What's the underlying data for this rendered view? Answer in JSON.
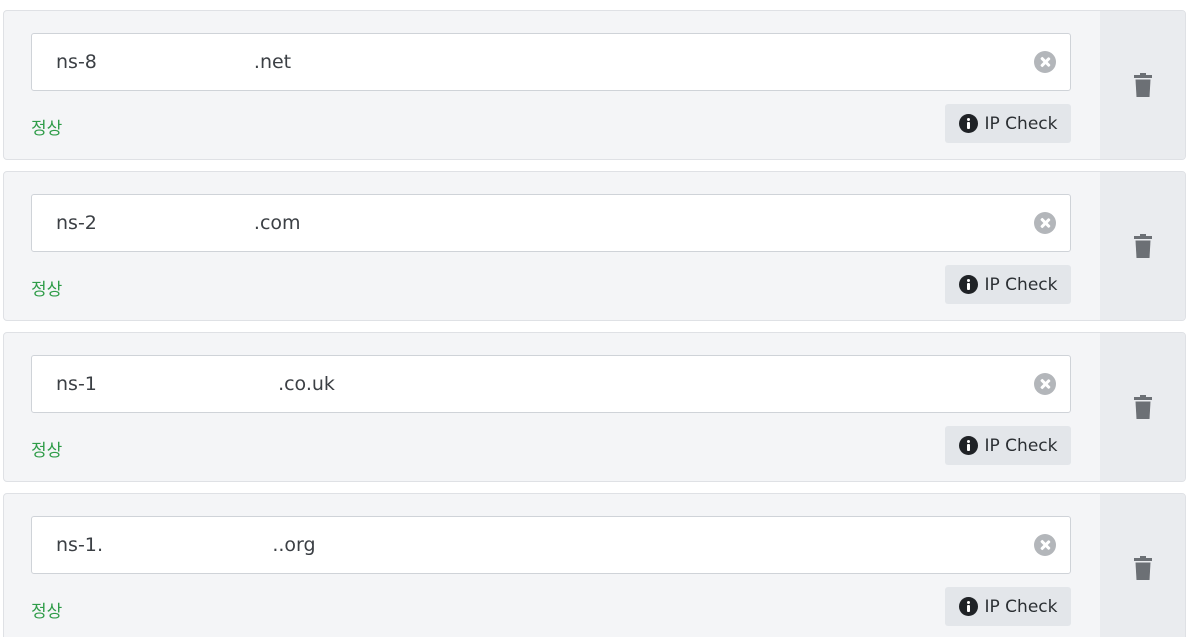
{
  "entries": [
    {
      "value": "ns-8                          .net",
      "status": "정상",
      "ip_check_label": "IP Check"
    },
    {
      "value": "ns-2                          .com",
      "status": "정상",
      "ip_check_label": "IP Check"
    },
    {
      "value": "ns-1                              .co.uk",
      "status": "정상",
      "ip_check_label": "IP Check"
    },
    {
      "value": "ns-1․                            ..org",
      "status": "정상",
      "ip_check_label": "IP Check"
    }
  ],
  "icons": {
    "clear": "circle-x-icon",
    "info": "info-circle-icon",
    "delete": "trash-icon"
  },
  "colors": {
    "status_ok": "#2e9c48",
    "card_bg": "#f4f5f7",
    "delete_col_bg": "#eaecef",
    "icon_gray": "#6c7075"
  }
}
